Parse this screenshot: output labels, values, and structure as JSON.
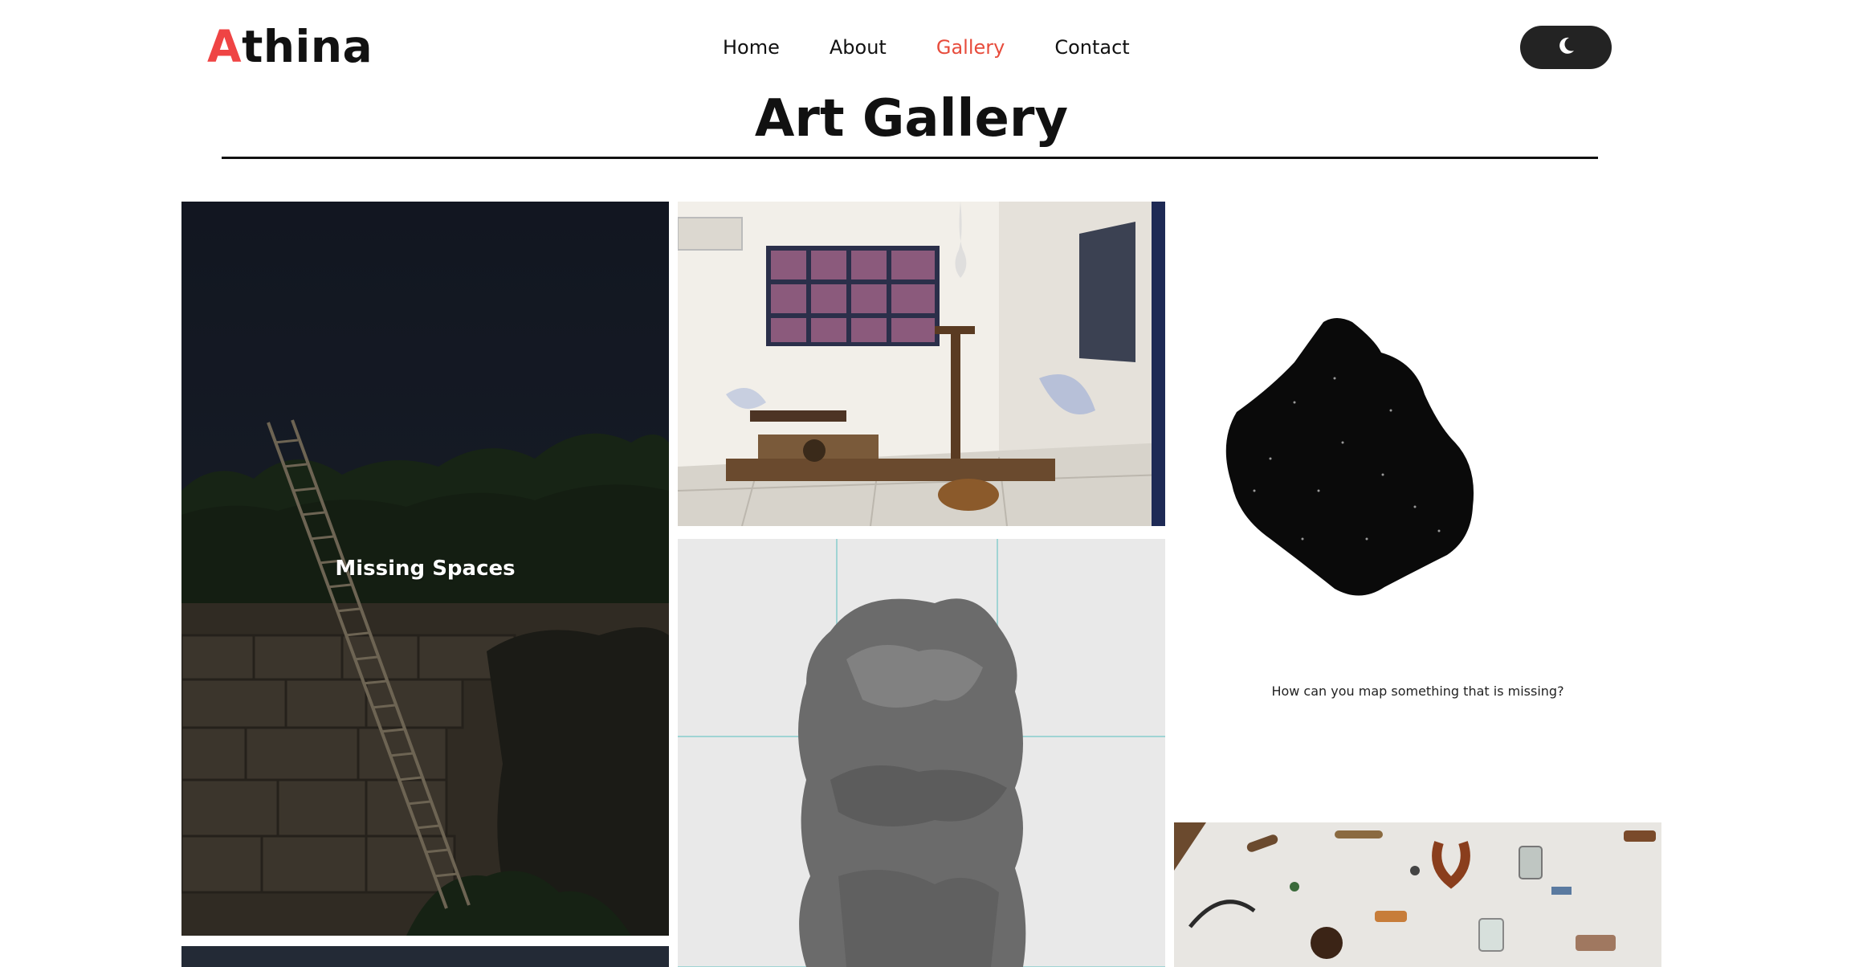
{
  "header": {
    "logo_first": "A",
    "logo_rest": "thina",
    "nav": [
      {
        "label": "Home"
      },
      {
        "label": "About"
      },
      {
        "label": "Gallery"
      },
      {
        "label": "Contact"
      }
    ],
    "active_nav": "Gallery",
    "theme_icon": "moon-icon"
  },
  "main": {
    "title": "Art Gallery"
  },
  "gallery": {
    "items": [
      {
        "label": "Missing Spaces",
        "icon": "ladder-on-ruins-image"
      },
      {
        "icon": "studio-installation-image"
      },
      {
        "caption": "How can you map something that is missing?",
        "icon": "black-blob-map-image"
      },
      {
        "icon": "rock-sculpture-image"
      },
      {
        "icon": "found-objects-image"
      },
      {
        "icon": "night-landscape-image"
      }
    ]
  },
  "colors": {
    "accent": "#ef4444",
    "active_nav": "#e74c3c",
    "toggle_bg": "#232323"
  }
}
